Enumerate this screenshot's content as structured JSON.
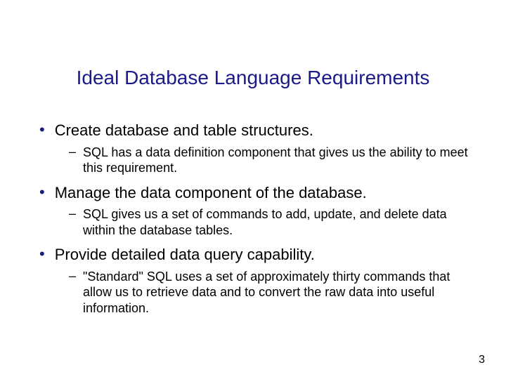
{
  "title": "Ideal Database Language Requirements",
  "bullets": [
    {
      "main": "Create database and table structures.",
      "sub": "SQL has a data definition component that gives us the ability to meet this requirement."
    },
    {
      "main": "Manage the data component of the database.",
      "sub": "SQL gives us a set of commands to add, update, and delete data within the database tables."
    },
    {
      "main": "Provide detailed data query capability.",
      "sub": "\"Standard\" SQL uses a set of approximately thirty commands that allow us to retrieve data and to convert the raw data into useful information."
    }
  ],
  "page_number": "3"
}
